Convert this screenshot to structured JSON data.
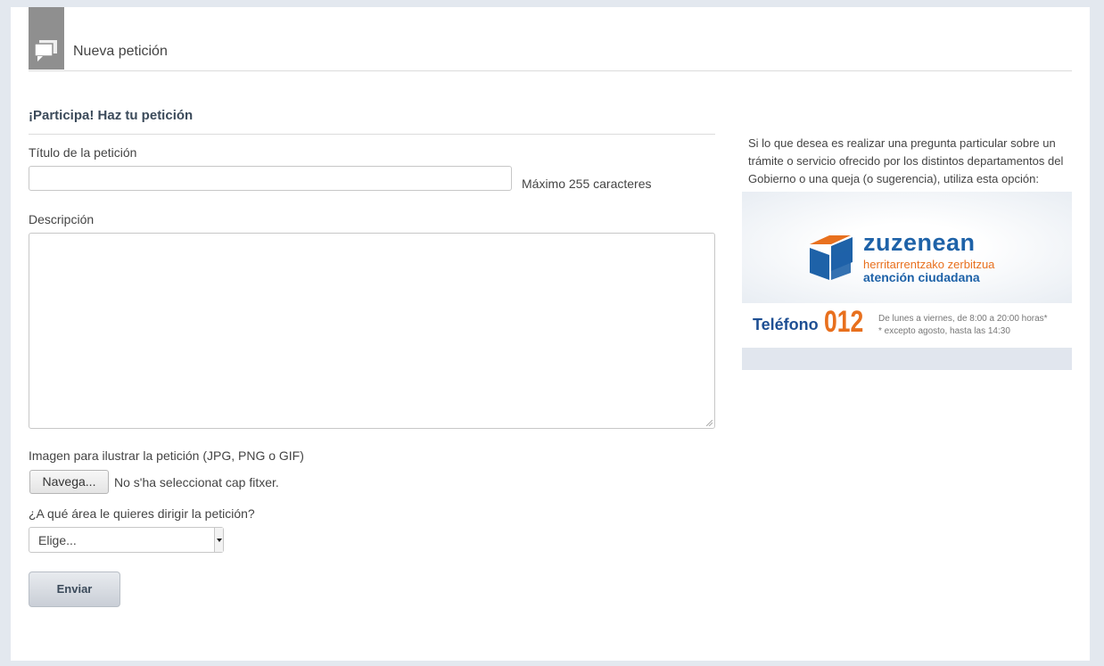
{
  "header": {
    "title": "Nueva petición",
    "icon": "chat-bubbles-icon"
  },
  "form": {
    "section_title": "¡Participa! Haz tu petición",
    "title_label": "Título de la petición",
    "title_value": "",
    "title_hint": "Máximo 255 caracteres",
    "description_label": "Descripción",
    "description_value": "",
    "image_label": "Imagen para ilustrar la petición (JPG, PNG o GIF)",
    "browse_label": "Navega...",
    "file_status": "No s'ha seleccionat cap fitxer.",
    "area_label": "¿A qué área le quieres dirigir la petición?",
    "area_selected": "Elige...",
    "submit_label": "Enviar"
  },
  "sidebar": {
    "info_text": "Si lo que desea es realizar una pregunta particular sobre un trámite o servicio ofrecido por los distintos departamentos del Gobierno o una queja (o sugerencia), utiliza esta opción:",
    "banner": {
      "brand": "zuzenean",
      "subtitle_eu": "herritarrentzako zerbitzua",
      "subtitle_es": "atención ciudadana",
      "phone_label": "Teléfono",
      "phone_number": "012",
      "hours_line1": "De lunes a viernes, de 8:00 a 20:00 horas*",
      "hours_line2": "* excepto agosto, hasta las 14:30",
      "colors": {
        "blue": "#1e62a8",
        "orange": "#e8701e"
      }
    }
  }
}
